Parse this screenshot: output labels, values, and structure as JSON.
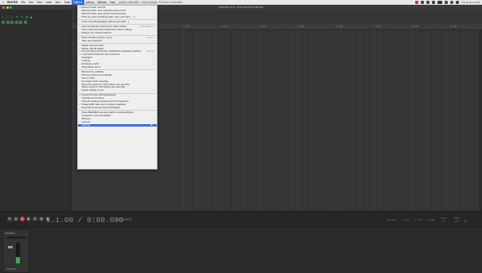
{
  "menubar": {
    "items": [
      "REAPER",
      "File",
      "Edit",
      "View",
      "Insert",
      "Item",
      "Track",
      "Options",
      "Actions",
      "Window",
      "Help"
    ],
    "active": "Options",
    "status_text": "[44kHz 24bit WAV : 1/2ch 512spls ~12/12ms CoreAudio]",
    "clock": "Tue 21 Jun  11:15"
  },
  "window": {
    "title": "REAPER v6.71 - EVALUATION LICENSE"
  },
  "ruler": {
    "marks": [
      "1.1.00",
      "2.1.00",
      "3.1.00",
      "4.1.00",
      "5.1.00",
      "6.1.00",
      "7.1.00",
      "8.1.00",
      "9.1.00"
    ]
  },
  "transport": {
    "time": "1.1.00 / 0:00.000",
    "status": "[Stopped]",
    "selection_label": "Selection:",
    "sel_start": "1.1.00",
    "sel_end": "1.1.00",
    "sel_len": "0.0.00",
    "rate_label": "Rate:",
    "rate": "1.0",
    "bpm_label": "BPM",
    "bpm": "120",
    "sig": "4/4"
  },
  "mixer": {
    "master_name": "MASTER",
    "master_label": "MASTER"
  },
  "colors": {
    "accent": "#3a6fd8",
    "record": "#d23a3a",
    "meter": "#3aa85a"
  },
  "options_menu": [
    {
      "label": "Record mode: normal",
      "checked": true
    },
    {
      "label": "Record mode: time selection auto punch"
    },
    {
      "label": "Record mode: auto-punch selected items"
    },
    {
      "label": "Prefs for new recording (start, stop, auto-arm, ...)",
      "submenu": true
    },
    {
      "sep": true
    },
    {
      "label": "Track recording/display options (overdub...)"
    },
    {
      "sep": true
    },
    {
      "label": "Auto-crossfade media items when editing",
      "checked": true,
      "shortcut": "Cmd+Opt+X"
    },
    {
      "label": "Trim content behind media items when editing"
    },
    {
      "label": "Always trim content behind ...",
      "checked": true
    },
    {
      "sep": true
    },
    {
      "label": "Show all takes (when room)",
      "checked": true,
      "shortcut": "Cmd+L"
    },
    {
      "label": "Take lane behavior",
      "submenu": true
    },
    {
      "sep": true
    },
    {
      "label": "Ripple edit per-track"
    },
    {
      "label": "Ripple edit all tracks"
    },
    {
      "label": "Item grouping and track media/razor grouping enabled",
      "checked": true,
      "shortcut": "Opt+G"
    },
    {
      "label": "Loop points linked to time selection",
      "checked": true
    },
    {
      "label": "Snap/grid",
      "submenu": true
    },
    {
      "label": "Locking",
      "submenu": true
    },
    {
      "label": "Envelope points",
      "submenu": true
    },
    {
      "label": "Automation items",
      "submenu": true
    },
    {
      "sep": true
    },
    {
      "label": "Metronome enabled"
    },
    {
      "label": "Metronome/pre-roll settings..."
    },
    {
      "label": "Solo in front"
    },
    {
      "label": "Pre-fader track metering"
    },
    {
      "label": "Show FX inserts in TCP (when size permits)"
    },
    {
      "label": "Show sends in TCP (when size permits)"
    },
    {
      "label": "Peaks display mode",
      "submenu": true
    },
    {
      "sep": true
    },
    {
      "label": "Autoscroll view during playback",
      "checked": true
    },
    {
      "label": "Continuous scrolling"
    },
    {
      "label": "Smooth seeking (seeks at end of measure)"
    },
    {
      "label": "Chase MIDI note-ons in project playback",
      "checked": true
    },
    {
      "label": "External Timecode Synchronization",
      "submenu": true
    },
    {
      "sep": true
    },
    {
      "label": "Show REAPER resource path in explorer/finder..."
    },
    {
      "label": "Customize menus/toolbars..."
    },
    {
      "label": "Themes",
      "submenu": true
    },
    {
      "label": "Layouts",
      "submenu": true
    },
    {
      "label": "Settings...",
      "shortcut": "⌘,",
      "highlighted": true
    }
  ]
}
